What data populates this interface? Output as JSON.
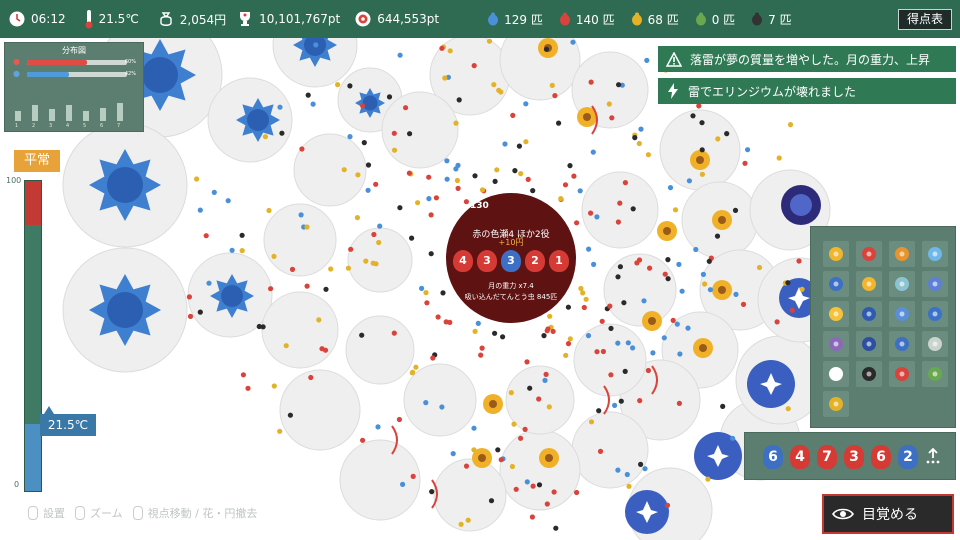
{
  "hud": {
    "time": "06:12",
    "temperature": "21.5℃",
    "money": "2,054円",
    "points": "10,101,767pt",
    "target_points": "644,553pt",
    "counts": [
      {
        "value": "129 匹",
        "color": "#4a90d9"
      },
      {
        "value": "140 匹",
        "color": "#d8433b"
      },
      {
        "value": "68 匹",
        "color": "#e3b227"
      },
      {
        "value": "0 匹",
        "color": "#6aa84f"
      },
      {
        "value": "7 匹",
        "color": "#333333"
      }
    ],
    "score_button": "得点表"
  },
  "distribution": {
    "title": "分布図",
    "red_pct": "60%",
    "blue_pct": "42%",
    "red_fill": 0.6,
    "blue_fill": 0.42,
    "histogram": [
      0.35,
      0.55,
      0.4,
      0.55,
      0.35,
      0.45,
      0.6
    ],
    "hist_labels": [
      "1",
      "2",
      "3",
      "4",
      "5",
      "6",
      "7"
    ]
  },
  "thermo": {
    "state": "平常",
    "max_label": "100",
    "min_label": "0",
    "current_temp": "21.5℃",
    "current_level": 0.215
  },
  "notices": [
    {
      "icon": "warning-icon",
      "text": "落雷が夢の質量を増やした。月の重力、上昇"
    },
    {
      "icon": "lightning-icon",
      "text": "雷でエリンジウムが壊れました"
    }
  ],
  "center": {
    "count": "130",
    "title": "赤の色瀬4 ほか2役",
    "bonus": "+10円",
    "dice": [
      "4",
      "3",
      "3",
      "2",
      "1"
    ],
    "dice_colors": [
      "red",
      "red",
      "blue",
      "red",
      "red"
    ],
    "gravity": "月の重力 x7.4",
    "absorbed": "吸い込んだてんとう虫 845匹"
  },
  "inventory": {
    "items": [
      "sunflower-icon",
      "red-rose-icon",
      "orange-flower-icon",
      "water-drop-icon",
      "blue-eye-flower-icon",
      "sunflower-small-icon",
      "orchid-icon",
      "blue-star-flower-icon",
      "yellow-sun-icon",
      "blue-orb-icon",
      "pinwheel-icon",
      "bluebell-icon",
      "purple-thistle-icon",
      "spiral-flower-icon",
      "blue-pinwheel-icon",
      "lock-icon",
      "exit-icon",
      "phone-icon",
      "battery-icon",
      "green-card-icon",
      "eye-pyramid-icon"
    ]
  },
  "tray": {
    "dice": [
      "6",
      "4",
      "7",
      "3",
      "6",
      "2"
    ],
    "colors": [
      "#3d6fc4",
      "#d63a34",
      "#d63a34",
      "#d63a34",
      "#d63a34",
      "#3d6fc4"
    ]
  },
  "wake_button": "目覚める",
  "hints": [
    "設置",
    "ズーム",
    "視点移動 / 花・円撤去"
  ]
}
